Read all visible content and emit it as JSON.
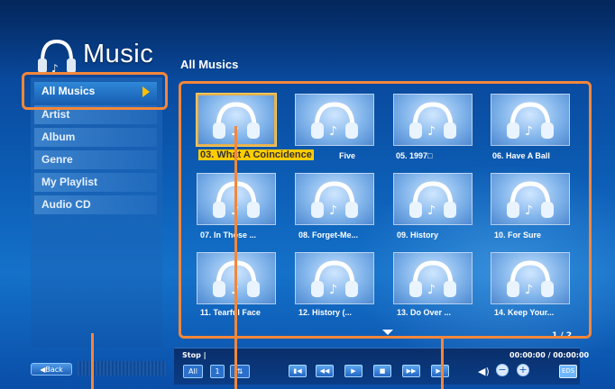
{
  "header": {
    "app_title": "Music",
    "section_title": "All Musics",
    "logo_icon": "headphones-icon"
  },
  "sidebar": {
    "items": [
      {
        "label": "All Musics",
        "active": true
      },
      {
        "label": "Artist"
      },
      {
        "label": "Album"
      },
      {
        "label": "Genre"
      },
      {
        "label": "My Playlist"
      },
      {
        "label": "Audio CD"
      }
    ]
  },
  "grid": {
    "items": [
      {
        "label": "03. What A Coincidence",
        "selected": true
      },
      {
        "label": "Five",
        "selected": false
      },
      {
        "label": "05. 1997□",
        "selected": false
      },
      {
        "label": "06. Have A Ball",
        "selected": false
      },
      {
        "label": "07. In Those ...",
        "selected": false
      },
      {
        "label": "08. Forget-Me...",
        "selected": false
      },
      {
        "label": "09. History",
        "selected": false
      },
      {
        "label": "10. For Sure",
        "selected": false
      },
      {
        "label": "11. Tearful Face",
        "selected": false
      },
      {
        "label": "12. History (...",
        "selected": false
      },
      {
        "label": "13. Do Over ...",
        "selected": false
      },
      {
        "label": "14. Keep Your...",
        "selected": false
      }
    ],
    "page_indicator": "1 / 2",
    "thumbnail_icon": "headphones-icon"
  },
  "bottom": {
    "back_label": "Back",
    "status": "Stop |",
    "time": "00:00:00 / 00:00:00",
    "mode_all": "All",
    "mode_one": "1",
    "mode_shuffle": "⇅",
    "eds_label": "EDS"
  },
  "colors": {
    "callout": "#f4873a",
    "selected_highlight": "#ffcc00",
    "background_dark": "#063b8c",
    "background_light": "#1471c9"
  }
}
